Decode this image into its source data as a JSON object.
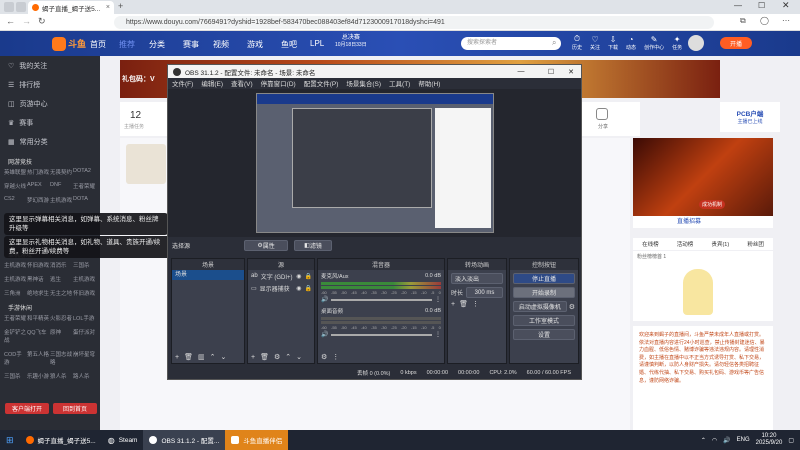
{
  "browser": {
    "tab_title": "蝎子直播_蝎子送5...",
    "url": "https://www.douyu.com/7669491?dyshid=1928bef-583470bec088403ef84d7123000917018dyshci=491"
  },
  "douyu": {
    "logo": "斗鱼",
    "nav": [
      "首页",
      "推荐",
      "分类",
      "赛事",
      "视频",
      "游戏",
      "鱼吧",
      "LPL"
    ],
    "nav_badge": "总决赛",
    "nav_badge_sub": "10月18日33日",
    "search_placeholder": "搜索探索者",
    "right_icons": [
      "历史",
      "关注",
      "下载",
      "动态",
      "创作中心",
      "任务"
    ],
    "live_button": "开播",
    "sidebar": {
      "top_items": [
        "我的关注",
        "排行榜",
        "页游中心",
        "赛事",
        "常用分类"
      ],
      "hot_label": "网游竞技",
      "hot_grid": [
        "英雄联盟",
        "热门游戏",
        "无畏契约",
        "DOTA2",
        "穿越火线",
        "APEX",
        "DNF",
        "王者荣耀",
        "CS2",
        "梦幻西游",
        "主机游戏",
        "DOTA"
      ],
      "mobile_label": "单机游戏",
      "mobile_grid": [
        "主机游戏",
        "怀旧游戏",
        "消消乐",
        "三国杀",
        "主机游戏",
        "黑神话",
        "逃生",
        "主机游戏",
        "三角洲",
        "绝地求生",
        "无主之地",
        "怀旧游戏"
      ],
      "phone_label": "手游休闲",
      "phone_grid": [
        "王者荣耀",
        "和平精英",
        "火影忍者",
        "LOL手游",
        "金铲铲之战",
        "QQ飞车",
        "原神",
        "蛋仔派对",
        "COD手游",
        "第五人格",
        "三国志战略",
        "崩坏星穹",
        "三国杀",
        "乐趣小游",
        "狼人杀",
        "路人杀"
      ],
      "btn1": "客户端打开",
      "btn2": "回到首页"
    },
    "room": {
      "follow_count": "12",
      "follow_label": "主播任务",
      "gift_banner": "礼包码：V",
      "tabs": [
        "在线榜",
        "活动榜",
        "贵宾(1)",
        "粉丝团"
      ],
      "fan_label": "粉丝榜榜首 1",
      "share_label": "分享",
      "pcb_label": "PCB户端",
      "pcb_sub": "主播已上线",
      "notice": "欢迎来到蝎子的直播间，斗鱼严禁未成年人直播或打赏。依法对直播内容进行24小时巡查，禁止传播封建迷信、暴力血腥、低俗色情、赌博诈骗等违法违规内容。请理性消费，如主播在直播中以不正当方式诱导打赏、私下交易，请谨慎判断，以防人身财产损失。请勿轻信各类招聘征婚、代练代抽、私下交易、购买礼包码、游戏币等广告信息，谨防网络诈骗。",
      "video_tag1": "直播招募",
      "video_tag2": "成功机制"
    }
  },
  "tooltips": {
    "tip1": "这里显示弹幕相关消息，如弹幕、系统消息、粉丝牌升级等",
    "tip2": "这里显示礼物相关消息，如礼物、道具、贵族开通/续费，粉丝开通/续费等"
  },
  "obs": {
    "title": "OBS 31.1.2 - 配置文件: 未命名 - 场景: 未命名",
    "menu": [
      "文件(F)",
      "编辑(E)",
      "查看(V)",
      "停靠窗口(D)",
      "配置文件(P)",
      "场景集合(S)",
      "工具(T)",
      "帮助(H)"
    ],
    "mini_labels": [
      "选择源",
      "属性",
      "滤镜"
    ],
    "docks": {
      "scenes": {
        "title": "场景",
        "items": [
          "场景"
        ]
      },
      "sources": {
        "title": "源",
        "items": [
          "文字 (GDI+)",
          "显示器捕获"
        ]
      },
      "mixer": {
        "title": "混音器",
        "channels": [
          {
            "name": "麦克风/Aux",
            "db": "0.0 dB"
          },
          {
            "name": "桌面音频",
            "db": "0.0 dB"
          }
        ],
        "scale": [
          "-60",
          "-55",
          "-50",
          "-45",
          "-40",
          "-35",
          "-30",
          "-25",
          "-20",
          "-15",
          "-10",
          "-5",
          "0"
        ]
      },
      "transitions": {
        "title": "转场动画",
        "type": "淡入淡出",
        "duration_label": "时长",
        "duration": "300 ms"
      },
      "controls": {
        "title": "控制按钮",
        "buttons": [
          "停止直播",
          "开始录制",
          "启动虚拟摄像机",
          "工作室模式",
          "设置"
        ]
      }
    },
    "status": {
      "frames": "丢帧 0 (0.0%)",
      "net": "0 kbps",
      "rec": "00:00:00",
      "live": "00:00:00",
      "cpu": "CPU: 2.0%",
      "fps": "60.00 / 60.00 FPS"
    }
  },
  "taskbar": {
    "items": [
      "蝎子直播_蝎子送5...",
      "Steam",
      "OBS 31.1.2 - 配置...",
      "斗鱼直播伴侣"
    ],
    "lang": "ENG",
    "time": "10:20",
    "date": "2025/9/20"
  },
  "colors": {
    "douyu_blue": "#2a4fb5",
    "obs_bg": "#2b2e38",
    "accent_orange": "#ff5d23",
    "taskbar": "#1f2532"
  }
}
